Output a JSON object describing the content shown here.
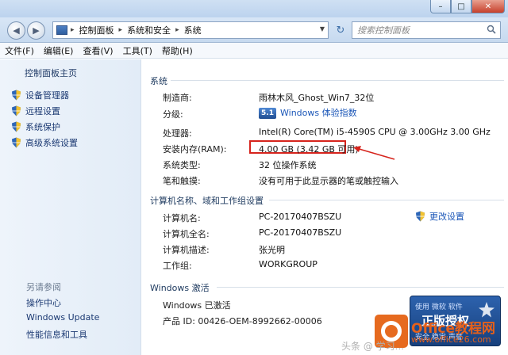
{
  "breadcrumb": [
    "控制面板",
    "系统和安全",
    "系统"
  ],
  "search": {
    "placeholder": "搜索控制面板"
  },
  "menu": [
    "文件(F)",
    "编辑(E)",
    "查看(V)",
    "工具(T)",
    "帮助(H)"
  ],
  "sidebar": {
    "home": "控制面板主页",
    "links": [
      "设备管理器",
      "远程设置",
      "系统保护",
      "高级系统设置"
    ],
    "see_also_title": "另请参阅",
    "see_also": [
      "操作中心",
      "Windows Update",
      "性能信息和工具"
    ]
  },
  "system": {
    "section_title": "系统",
    "rows": [
      {
        "label": "制造商:",
        "value": "雨林木风_Ghost_Win7_32位"
      },
      {
        "label": "分级:",
        "badge": "5.1",
        "value": "Windows 体验指数"
      },
      {
        "label": "处理器:",
        "value": "Intel(R) Core(TM) i5-4590S CPU @ 3.00GHz   3.00 GHz"
      },
      {
        "label": "安装内存(RAM):",
        "value": "4.00 GB (3.42 GB 可用)"
      },
      {
        "label": "系统类型:",
        "value": "32 位操作系统"
      },
      {
        "label": "笔和触摸:",
        "value": "没有可用于此显示器的笔或触控输入"
      }
    ]
  },
  "computer": {
    "section_title": "计算机名称、域和工作组设置",
    "change_label": "更改设置",
    "rows": [
      {
        "label": "计算机名:",
        "value": "PC-20170407BSZU"
      },
      {
        "label": "计算机全名:",
        "value": "PC-20170407BSZU"
      },
      {
        "label": "计算机描述:",
        "value": "张光明"
      },
      {
        "label": "工作组:",
        "value": "WORKGROUP"
      }
    ]
  },
  "activation": {
    "section_title": "Windows 激活",
    "status": "Windows 已激活",
    "product_id": "产品 ID: 00426-OEM-8992662-00006"
  },
  "genuine_badge": {
    "top": "使用 微软 软件",
    "main": "正版授权",
    "sub": "安全 稳定 声誉"
  },
  "watermark": {
    "line1": "Office教程网",
    "line2": "www.office26.com",
    "line3": "头条 @ 学习..."
  },
  "colors": {
    "highlight": "#d6241d",
    "link": "#1c57b8"
  }
}
